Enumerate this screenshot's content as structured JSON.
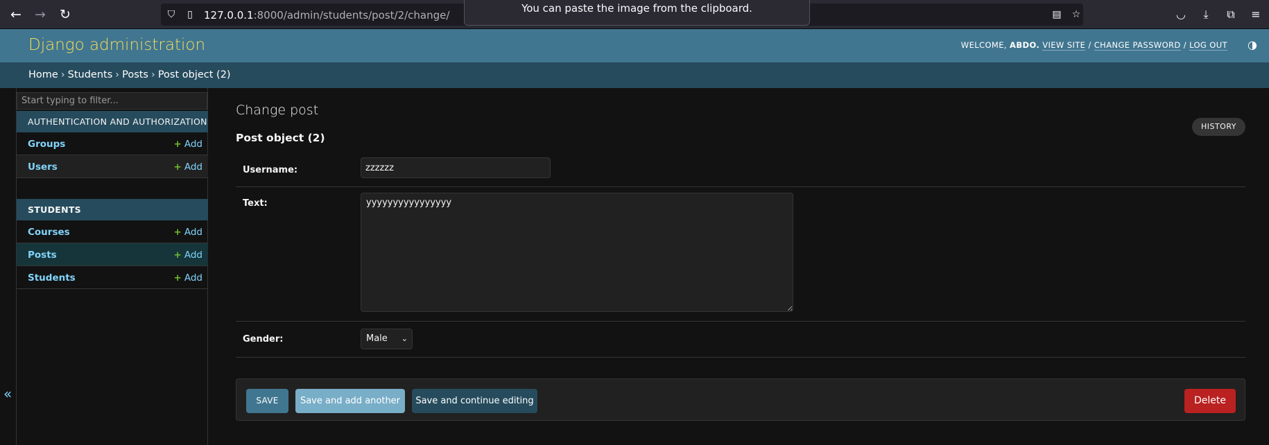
{
  "browser": {
    "url_host": "127.0.0.1",
    "url_rest": ":8000/admin/students/post/2/change/",
    "toast": "You can paste the image from the clipboard."
  },
  "header": {
    "branding": "Django administration",
    "welcome": "WELCOME,",
    "username": "ABDO.",
    "view_site": "VIEW SITE",
    "change_password": "CHANGE PASSWORD",
    "log_out": "LOG OUT",
    "sep": "/"
  },
  "breadcrumbs": {
    "home": "Home",
    "app": "Students",
    "model": "Posts",
    "current": "Post object (2)",
    "sep": "›"
  },
  "sidebar": {
    "filter_placeholder": "Start typing to filter...",
    "modules": [
      {
        "caption": "AUTHENTICATION AND AUTHORIZATION",
        "models": [
          {
            "name": "Groups",
            "add": "Add"
          },
          {
            "name": "Users",
            "add": "Add"
          }
        ]
      },
      {
        "caption": "STUDENTS",
        "models": [
          {
            "name": "Courses",
            "add": "Add"
          },
          {
            "name": "Posts",
            "add": "Add"
          },
          {
            "name": "Students",
            "add": "Add"
          }
        ]
      }
    ],
    "collapse": "«"
  },
  "main": {
    "title": "Change post",
    "object_title": "Post object (2)",
    "history": "HISTORY",
    "fields": {
      "username_label": "Username:",
      "username_value": "zzzzzz",
      "text_label": "Text:",
      "text_value": "yyyyyyyyyyyyyyyy",
      "gender_label": "Gender:",
      "gender_value": "Male"
    },
    "buttons": {
      "save": "SAVE",
      "save_add_another": "Save and add another",
      "save_continue": "Save and continue editing",
      "delete": "Delete"
    }
  },
  "colors": {
    "header_bg": "#417690",
    "breadcrumb_bg": "#264b5d",
    "branding": "#f5dd5d",
    "link": "#81d4fa",
    "add_plus": "#70bf2b",
    "delete": "#ba2121"
  }
}
